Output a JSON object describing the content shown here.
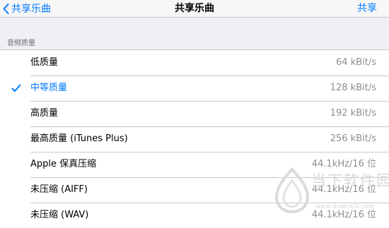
{
  "nav": {
    "back_label": "共享乐曲",
    "title": "共享乐曲",
    "action_label": "共享"
  },
  "section": {
    "header": "音频质量"
  },
  "options": [
    {
      "label": "低质量",
      "value": "64 kBit/s",
      "selected": false
    },
    {
      "label": "中等质量",
      "value": "128 kBit/s",
      "selected": true
    },
    {
      "label": "高质量",
      "value": "192 kBit/s",
      "selected": false
    },
    {
      "label": "最高质量 (iTunes Plus)",
      "value": "256 kBit/s",
      "selected": false
    },
    {
      "label": "Apple 保真压缩",
      "value": "44.1kHz/16 位",
      "selected": false
    },
    {
      "label": "未压缩 (AIFF)",
      "value": "44.1kHz/16 位",
      "selected": false
    },
    {
      "label": "未压缩 (WAV)",
      "value": "44.1kHz/16 位",
      "selected": false
    }
  ],
  "watermark": {
    "title": "当下软件园",
    "url": "www.downxia.com"
  },
  "colors": {
    "accent": "#007aff",
    "background": "#efeff4",
    "secondary_text": "#8e8e93",
    "separator": "#c8c7cc"
  },
  "icons": {
    "back": "chevron-left-icon",
    "selected": "checkmark-icon"
  }
}
